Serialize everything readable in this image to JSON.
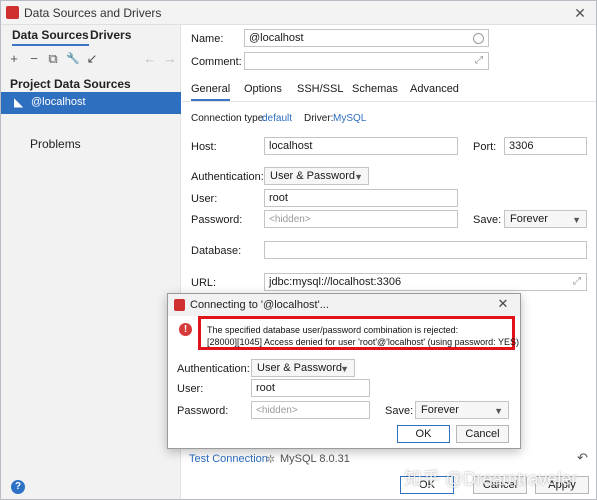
{
  "window": {
    "title": "Data Sources and Drivers",
    "close_glyph": "✕"
  },
  "sidebar": {
    "tabs": [
      "Data Sources",
      "Drivers"
    ],
    "toolbar": {
      "add": "+",
      "remove": "−",
      "copy": "⧉",
      "settings": "🔧",
      "move": "↙",
      "back": "←",
      "forward": "→"
    },
    "section_title": "Project Data Sources",
    "selected_item": "@localhost",
    "problems_label": "Problems",
    "help_glyph": "?"
  },
  "form": {
    "name_label": "Name:",
    "name_value": "@localhost",
    "comment_label": "Comment:",
    "comment_value": "",
    "tabs": [
      "General",
      "Options",
      "SSH/SSL",
      "Schemas",
      "Advanced"
    ],
    "active_tab": "General",
    "connection_type_label": "Connection type:",
    "connection_type_value": "default",
    "driver_label": "Driver:",
    "driver_value": "MySQL",
    "host_label": "Host:",
    "host_value": "localhost",
    "port_label": "Port:",
    "port_value": "3306",
    "auth_label": "Authentication:",
    "auth_value": "User & Password",
    "user_label": "User:",
    "user_value": "root",
    "password_label": "Password:",
    "password_placeholder": "<hidden>",
    "save_label": "Save:",
    "save_value": "Forever",
    "database_label": "Database:",
    "database_value": "",
    "url_label": "URL:",
    "url_value": "jdbc:mysql://localhost:3306",
    "test_connection": "Test Connection",
    "driver_version": "MySQL 8.0.31",
    "buttons": {
      "ok": "OK",
      "cancel": "Cancel",
      "apply": "Apply"
    }
  },
  "dialog": {
    "title": "Connecting to '@localhost'...",
    "close_glyph": "✕",
    "error_icon": "!",
    "error_line1": "The specified database user/password combination is rejected:",
    "error_line2": "[28000][1045] Access denied for user 'root'@'localhost' (using password: YES)",
    "auth_label": "Authentication:",
    "auth_value": "User & Password",
    "user_label": "User:",
    "user_value": "root",
    "password_label": "Password:",
    "password_placeholder": "<hidden>",
    "save_label": "Save:",
    "save_value": "Forever",
    "ok": "OK",
    "cancel": "Cancel"
  },
  "watermark": "知乎 @Dreamtraveler",
  "colors": {
    "accent": "#2f6fbf",
    "error": "#e0121a",
    "link": "#2d6fc0"
  }
}
